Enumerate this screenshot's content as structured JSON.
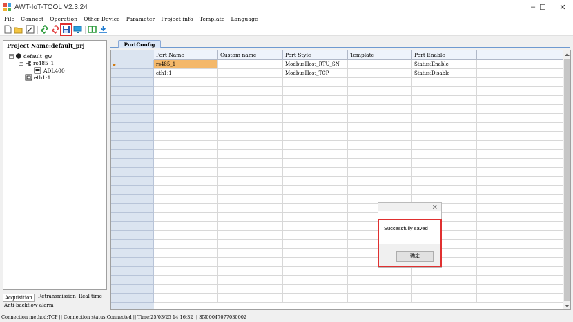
{
  "window": {
    "title": "AWT-IoT-TOOL V2.3.24",
    "minimize": "–",
    "maximize": "☐",
    "close": "✕"
  },
  "menu": [
    "File",
    "Connect",
    "Operation",
    "Other Device",
    "Parameter",
    "Project info",
    "Template",
    "Language"
  ],
  "toolbar_icons": [
    "new-file-icon",
    "open-folder-icon",
    "edit-icon",
    "connect-link-icon",
    "disconnect-link-icon",
    "save-icon",
    "monitor-icon",
    "split-icon",
    "download-icon"
  ],
  "project": {
    "name_label": "Project Name:default_prj",
    "tree": {
      "root": "default_gw",
      "port1": "rs485_1",
      "device1": "ADL400",
      "port2": "eth1:1"
    }
  },
  "left_tabs": [
    "Acquisition",
    "Retransmission",
    "Real time",
    "Anti-backflow alarm"
  ],
  "tab": "PortConfig",
  "grid": {
    "columns": [
      "Port Name",
      "Custom name",
      "Port Style",
      "Template",
      "Port Enable"
    ],
    "rows": [
      [
        "rs485_1",
        "",
        "ModbusHost_RTU_SN",
        "",
        "Status:Enable"
      ],
      [
        "eth1:1",
        "",
        "ModbusHost_TCP",
        "",
        "Status:Disable"
      ]
    ],
    "row_marker": "▸"
  },
  "dialog": {
    "message": "Successfully saved",
    "ok": "确定",
    "close": "✕"
  },
  "status": "Connection method:TCP || Connection status:Connected || Time:25/03/25 14:16:32 || SN00047077030002",
  "colors": {
    "highlight": "#e03030",
    "selected_cell": "#f4b86a",
    "tab_blue": "#6f9ad0"
  }
}
